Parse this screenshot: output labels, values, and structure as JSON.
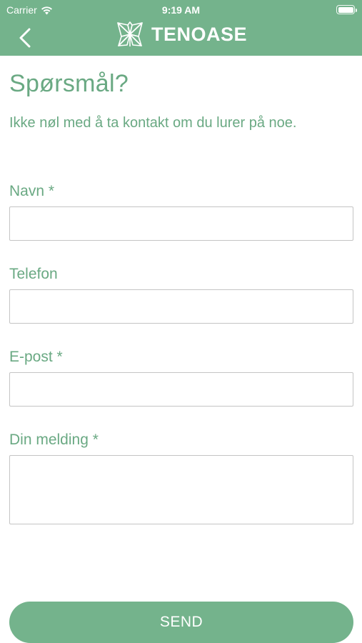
{
  "status_bar": {
    "carrier": "Carrier",
    "time": "9:19 AM",
    "battery_level": 1.0
  },
  "nav": {
    "back_icon": "chevron-left-icon",
    "brand_icon": "butterfly-logo-icon",
    "brand_name": "TENOASE"
  },
  "page": {
    "title": "Spørsmål?",
    "intro": "Ikke nøl med å ta kontakt om du lurer på noe."
  },
  "form": {
    "fields": [
      {
        "label": "Navn *",
        "value": "",
        "type": "text"
      },
      {
        "label": "Telefon",
        "value": "",
        "type": "tel"
      },
      {
        "label": "E-post *",
        "value": "",
        "type": "email"
      },
      {
        "label": "Din melding *",
        "value": "",
        "type": "textarea"
      }
    ],
    "submit_label": "SEND"
  },
  "colors": {
    "brand_green": "#74b38c",
    "text_green": "#6aa983",
    "input_border": "#c4c4c4"
  }
}
